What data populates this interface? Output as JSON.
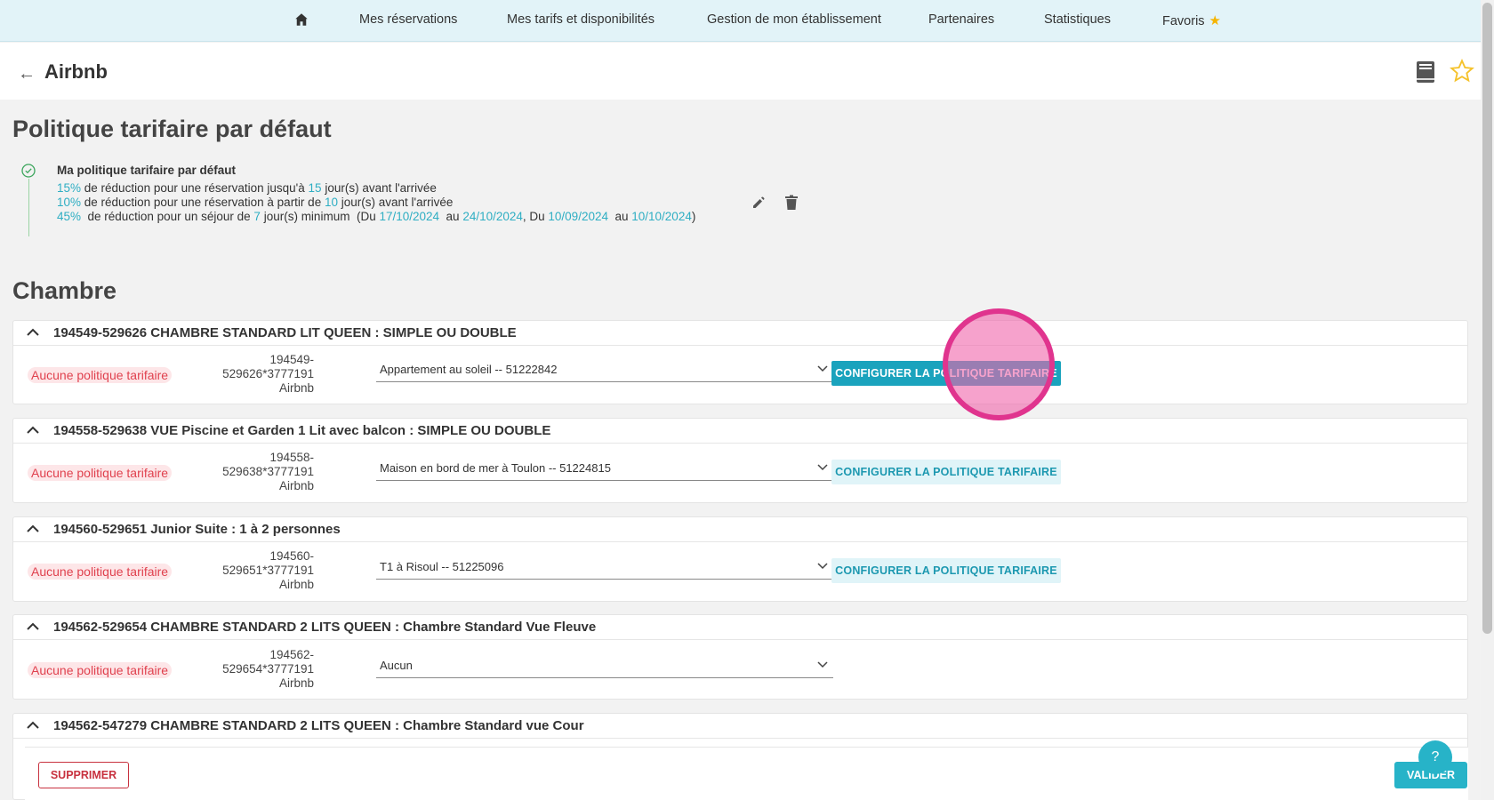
{
  "nav": {
    "items": [
      "Mes réservations",
      "Mes tarifs et disponibilités",
      "Gestion de mon établissement",
      "Partenaires",
      "Statistiques",
      "Favoris"
    ]
  },
  "header": {
    "title": "Airbnb"
  },
  "policy_section": {
    "title": "Politique tarifaire par défaut",
    "policy_title": "Ma politique tarifaire par défaut",
    "row1": {
      "pct": "15%",
      "text1": " de réduction pour une réservation jusqu'à ",
      "days": "15",
      "text2": " jour(s) avant l'arrivée"
    },
    "row2": {
      "pct": "10%",
      "text1": " de réduction pour une réservation à partir de ",
      "days": "10",
      "text2": " jour(s) avant l'arrivée"
    },
    "row3": {
      "pct": "45%",
      "text1": "  de réduction pour un séjour de ",
      "days": "7",
      "text2": " jour(s) minimum  (Du ",
      "d1": "17/10/2024",
      "au1": "  au ",
      "d2": "24/10/2024",
      "sep": ", Du ",
      "d3": "10/09/2024",
      "au2": "  au ",
      "d4": "10/10/2024",
      "end": ")"
    }
  },
  "rooms_section": {
    "title": "Chambre",
    "rooms": [
      {
        "title": "194549-529626 CHAMBRE STANDARD LIT QUEEN : SIMPLE OU DOUBLE",
        "badge": "Aucune politique tarifaire",
        "id_line1": "194549-",
        "id_line2": "529626*3777191",
        "id_line3": "Airbnb",
        "select_value": "Appartement au soleil -- 51222842",
        "button": "CONFIGURER LA POLITIQUE TARIFAIRE"
      },
      {
        "title": "194558-529638 VUE Piscine et Garden 1 Lit avec balcon : SIMPLE OU DOUBLE",
        "badge": "Aucune politique tarifaire",
        "id_line1": "194558-",
        "id_line2": "529638*3777191",
        "id_line3": "Airbnb",
        "select_value": "Maison en bord de mer à Toulon -- 51224815",
        "button": "CONFIGURER LA POLITIQUE TARIFAIRE"
      },
      {
        "title": "194560-529651 Junior Suite : 1 à 2 personnes",
        "badge": "Aucune politique tarifaire",
        "id_line1": "194560-",
        "id_line2": "529651*3777191",
        "id_line3": "Airbnb",
        "select_value": "T1 à Risoul -- 51225096",
        "button": "CONFIGURER LA POLITIQUE TARIFAIRE"
      },
      {
        "title": "194562-529654 CHAMBRE STANDARD 2 LITS QUEEN : Chambre Standard Vue Fleuve",
        "badge": "Aucune politique tarifaire",
        "id_line1": "194562-",
        "id_line2": "529654*3777191",
        "id_line3": "Airbnb",
        "select_value": "Aucun"
      },
      {
        "title": "194562-547279 CHAMBRE STANDARD 2 LITS QUEEN : Chambre Standard vue Cour"
      }
    ]
  },
  "footer": {
    "delete": "SUPPRIMER",
    "validate": "VALIDER",
    "help": "?"
  },
  "colors": {
    "accent": "#1aa3bd",
    "danger": "#e0414e",
    "nav_bg": "#e2f3f8"
  }
}
